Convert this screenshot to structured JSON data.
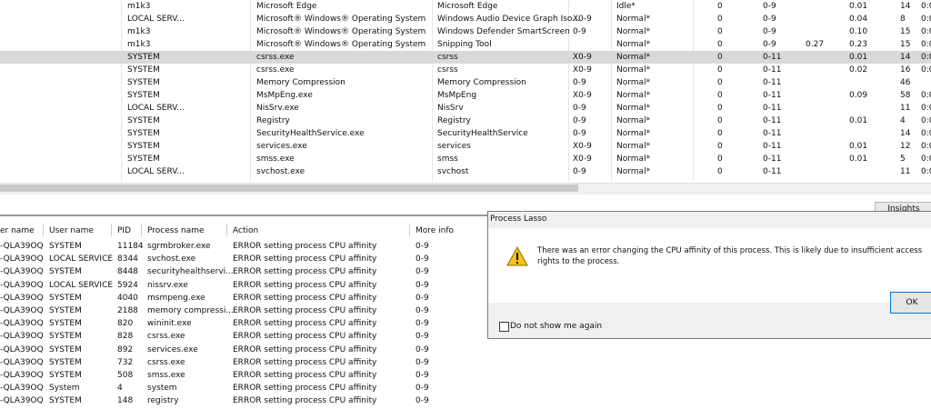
{
  "process_table": {
    "rows": [
      {
        "user": "m1k3",
        "company": "Microsoft Edge",
        "description": "Microsoft Edge",
        "affinity": "",
        "priority": "Idle*",
        "c1": "0",
        "c2": "0-9",
        "c3": "",
        "c4": "0.01",
        "c5": "14",
        "c6": "0:0"
      },
      {
        "user": "LOCAL SERV...",
        "company": "Microsoft® Windows® Operating System",
        "description": "Windows Audio Device Graph Iso...",
        "affinity": "X0-9",
        "priority": "Normal*",
        "c1": "0",
        "c2": "0-9",
        "c3": "",
        "c4": "0.04",
        "c5": "8",
        "c6": "0:0"
      },
      {
        "user": "m1k3",
        "company": "Microsoft® Windows® Operating System",
        "description": "Windows Defender SmartScreen",
        "affinity": "0-9",
        "priority": "Normal*",
        "c1": "0",
        "c2": "0-9",
        "c3": "",
        "c4": "0.10",
        "c5": "15",
        "c6": "0:0"
      },
      {
        "user": "m1k3",
        "company": "Microsoft® Windows® Operating System",
        "description": "Snipping Tool",
        "affinity": "",
        "priority": "Normal*",
        "c1": "0",
        "c2": "0-9",
        "c3": "0.27",
        "c4": "0.23",
        "c5": "15",
        "c6": "0:0"
      },
      {
        "user": "SYSTEM",
        "company": "csrss.exe",
        "description": "csrss",
        "affinity": "X0-9",
        "priority": "Normal*",
        "c1": "0",
        "c2": "0-11",
        "c3": "",
        "c4": "0.01",
        "c5": "14",
        "c6": "0:0"
      },
      {
        "user": "SYSTEM",
        "company": "csrss.exe",
        "description": "csrss",
        "affinity": "X0-9",
        "priority": "Normal*",
        "c1": "0",
        "c2": "0-11",
        "c3": "",
        "c4": "0.02",
        "c5": "16",
        "c6": "0:0"
      },
      {
        "user": "SYSTEM",
        "company": "Memory Compression",
        "description": "Memory Compression",
        "affinity": "0-9",
        "priority": "Normal*",
        "c1": "0",
        "c2": "0-11",
        "c3": "",
        "c4": "",
        "c5": "46",
        "c6": ""
      },
      {
        "user": "SYSTEM",
        "company": "MsMpEng.exe",
        "description": "MsMpEng",
        "affinity": "X0-9",
        "priority": "Normal*",
        "c1": "0",
        "c2": "0-11",
        "c3": "",
        "c4": "0.09",
        "c5": "58",
        "c6": "0:0"
      },
      {
        "user": "LOCAL SERV...",
        "company": "NisSrv.exe",
        "description": "NisSrv",
        "affinity": "0-9",
        "priority": "Normal*",
        "c1": "0",
        "c2": "0-11",
        "c3": "",
        "c4": "",
        "c5": "11",
        "c6": "0:0"
      },
      {
        "user": "SYSTEM",
        "company": "Registry",
        "description": "Registry",
        "affinity": "0-9",
        "priority": "Normal*",
        "c1": "0",
        "c2": "0-11",
        "c3": "",
        "c4": "0.01",
        "c5": "4",
        "c6": "0:0"
      },
      {
        "user": "SYSTEM",
        "company": "SecurityHealthService.exe",
        "description": "SecurityHealthService",
        "affinity": "0-9",
        "priority": "Normal*",
        "c1": "0",
        "c2": "0-11",
        "c3": "",
        "c4": "",
        "c5": "14",
        "c6": "0:0"
      },
      {
        "user": "SYSTEM",
        "company": "services.exe",
        "description": "services",
        "affinity": "X0-9",
        "priority": "Normal*",
        "c1": "0",
        "c2": "0-11",
        "c3": "",
        "c4": "0.01",
        "c5": "12",
        "c6": "0:0"
      },
      {
        "user": "SYSTEM",
        "company": "smss.exe",
        "description": "smss",
        "affinity": "X0-9",
        "priority": "Normal*",
        "c1": "0",
        "c2": "0-11",
        "c3": "",
        "c4": "0.01",
        "c5": "5",
        "c6": "0:0"
      },
      {
        "user": "LOCAL SERV...",
        "company": "svchost.exe",
        "description": "svchost",
        "affinity": "0-9",
        "priority": "Normal*",
        "c1": "0",
        "c2": "0-11",
        "c3": "",
        "c4": "",
        "c5": "11",
        "c6": "0:0"
      }
    ],
    "selected_index": 4
  },
  "insights_tab": "Insights",
  "log": {
    "headers": [
      "er name",
      "User name",
      "PID",
      "Process name",
      "Action",
      "More info"
    ],
    "rows": [
      {
        "computer": "-QLA39OQ",
        "user": "SYSTEM",
        "pid": "11184",
        "process": "sgrmbroker.exe",
        "action": "ERROR setting process CPU affinity",
        "info": "0-9"
      },
      {
        "computer": "-QLA39OQ",
        "user": "LOCAL SERVICE",
        "pid": "8344",
        "process": "svchost.exe",
        "action": "ERROR setting process CPU affinity",
        "info": "0-9"
      },
      {
        "computer": "-QLA39OQ",
        "user": "SYSTEM",
        "pid": "8448",
        "process": "securityhealthservi...",
        "action": "ERROR setting process CPU affinity",
        "info": "0-9"
      },
      {
        "computer": "-QLA39OQ",
        "user": "LOCAL SERVICE",
        "pid": "5924",
        "process": "nissrv.exe",
        "action": "ERROR setting process CPU affinity",
        "info": "0-9"
      },
      {
        "computer": "-QLA39OQ",
        "user": "SYSTEM",
        "pid": "4040",
        "process": "msmpeng.exe",
        "action": "ERROR setting process CPU affinity",
        "info": "0-9"
      },
      {
        "computer": "-QLA39OQ",
        "user": "SYSTEM",
        "pid": "2188",
        "process": "memory compressi...",
        "action": "ERROR setting process CPU affinity",
        "info": "0-9"
      },
      {
        "computer": "-QLA39OQ",
        "user": "SYSTEM",
        "pid": "820",
        "process": "wininit.exe",
        "action": "ERROR setting process CPU affinity",
        "info": "0-9"
      },
      {
        "computer": "-QLA39OQ",
        "user": "SYSTEM",
        "pid": "828",
        "process": "csrss.exe",
        "action": "ERROR setting process CPU affinity",
        "info": "0-9"
      },
      {
        "computer": "-QLA39OQ",
        "user": "SYSTEM",
        "pid": "892",
        "process": "services.exe",
        "action": "ERROR setting process CPU affinity",
        "info": "0-9"
      },
      {
        "computer": "-QLA39OQ",
        "user": "SYSTEM",
        "pid": "732",
        "process": "csrss.exe",
        "action": "ERROR setting process CPU affinity",
        "info": "0-9"
      },
      {
        "computer": "-QLA39OQ",
        "user": "SYSTEM",
        "pid": "508",
        "process": "smss.exe",
        "action": "ERROR setting process CPU affinity",
        "info": "0-9"
      },
      {
        "computer": "-QLA39OQ",
        "user": "System",
        "pid": "4",
        "process": "system",
        "action": "ERROR setting process CPU affinity",
        "info": "0-9"
      },
      {
        "computer": "-QLA39OQ",
        "user": "SYSTEM",
        "pid": "148",
        "process": "registry",
        "action": "ERROR setting process CPU affinity",
        "info": "0-9"
      }
    ]
  },
  "dialog": {
    "title": "Process Lasso",
    "message": "There was an error changing the CPU affinity of this process. This is likely due to insufficient access rights to the process.",
    "ok_label": "OK",
    "checkbox_label": "Do not show me again",
    "checkbox_checked": false,
    "icon": "warning-icon"
  },
  "colors": {
    "selected_row": "#d9d9d9",
    "warning_yellow": "#f5c518",
    "ok_border": "#0078d7"
  }
}
